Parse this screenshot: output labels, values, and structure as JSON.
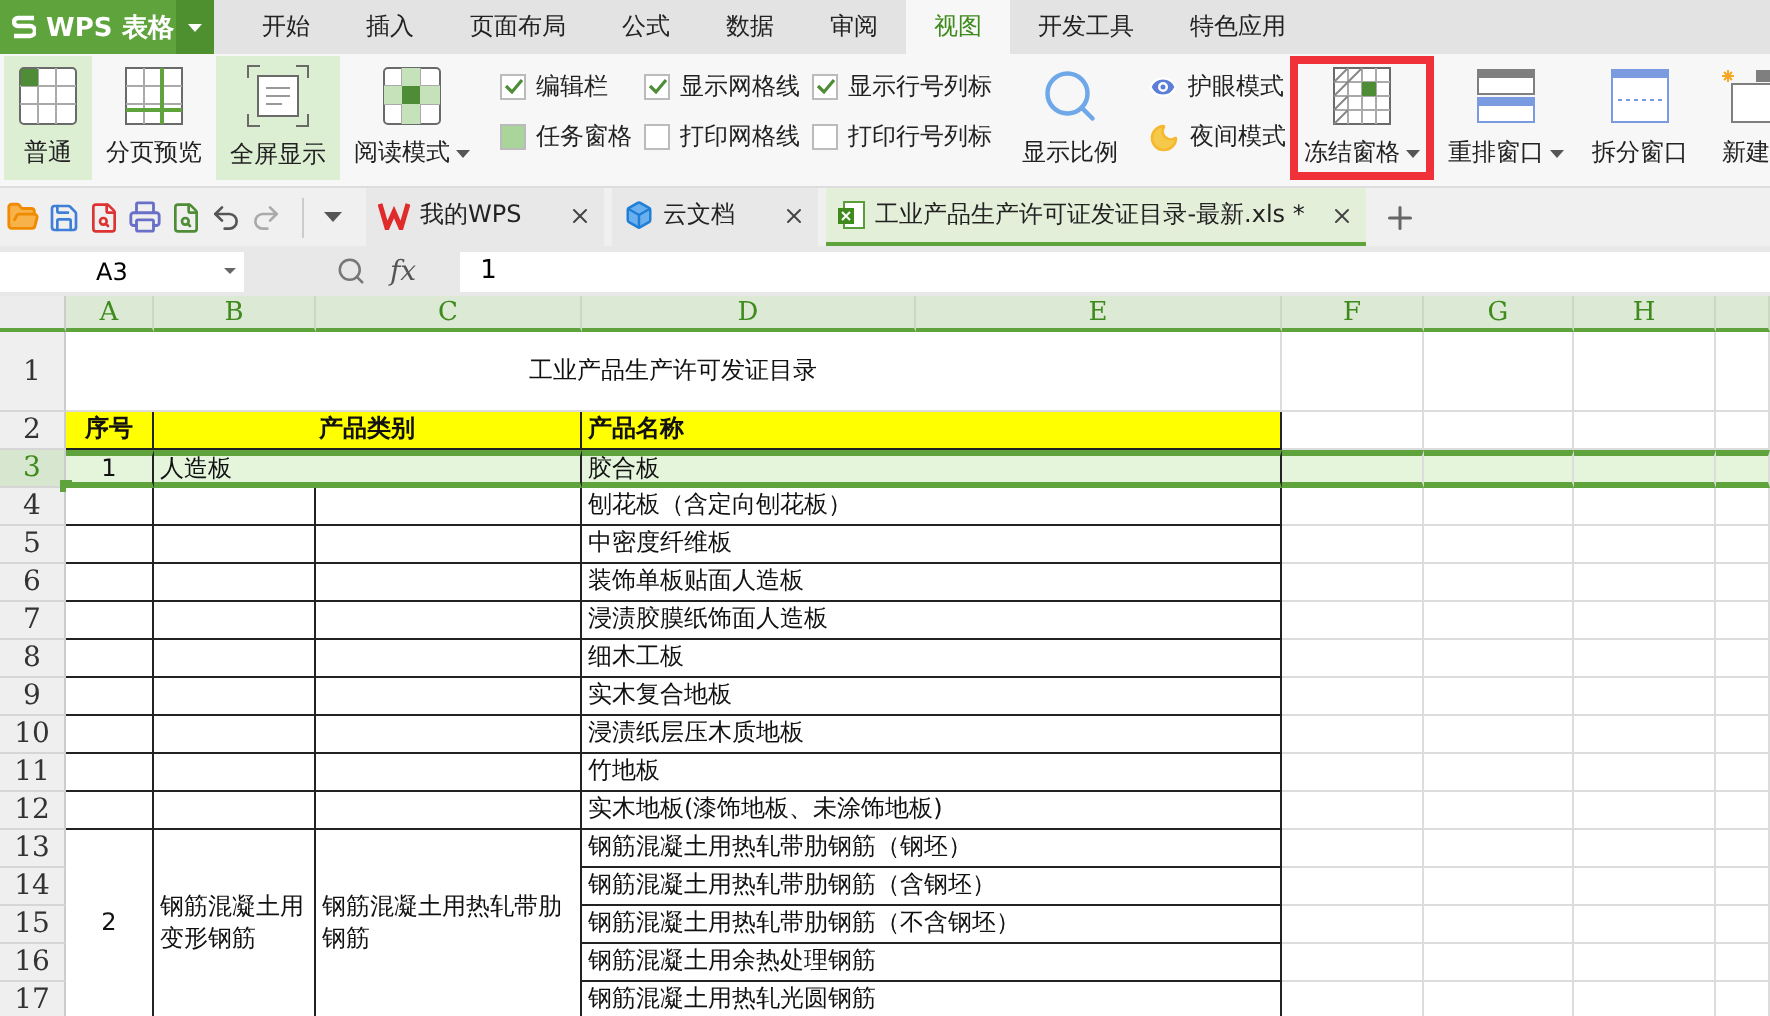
{
  "app": {
    "logo": "WPS 表格"
  },
  "menu_tabs": [
    {
      "label": "开始",
      "selected": false
    },
    {
      "label": "插入",
      "selected": false
    },
    {
      "label": "页面布局",
      "selected": false
    },
    {
      "label": "公式",
      "selected": false
    },
    {
      "label": "数据",
      "selected": false
    },
    {
      "label": "审阅",
      "selected": false
    },
    {
      "label": "视图",
      "selected": true
    },
    {
      "label": "开发工具",
      "selected": false
    },
    {
      "label": "特色应用",
      "selected": false
    }
  ],
  "view_buttons": [
    {
      "label": "普通",
      "kind": "normal",
      "highlighted": true,
      "dropdown": false
    },
    {
      "label": "分页预览",
      "kind": "pagebreak",
      "highlighted": false,
      "dropdown": false
    },
    {
      "label": "全屏显示",
      "kind": "fullscreen",
      "highlighted": true,
      "dropdown": false
    },
    {
      "label": "阅读模式",
      "kind": "reading",
      "highlighted": false,
      "dropdown": true
    }
  ],
  "show_checks": [
    {
      "label": "编辑栏",
      "kind": "tick",
      "checked": true
    },
    {
      "label": "任务窗格",
      "kind": "fill",
      "checked": true
    },
    {
      "label": "显示网格线",
      "kind": "tick",
      "checked": true
    },
    {
      "label": "打印网格线",
      "checked": false
    },
    {
      "label": "显示行号列标",
      "kind": "tick",
      "checked": true
    },
    {
      "label": "打印行号列标",
      "checked": false
    }
  ],
  "zoom_button": {
    "label": "显示比例"
  },
  "mode_buttons": [
    {
      "label": "护眼模式",
      "kind": "eye"
    },
    {
      "label": "夜间模式",
      "kind": "night"
    }
  ],
  "window_buttons": [
    {
      "label": "冻结窗格",
      "kind": "freeze",
      "dropdown": true,
      "framed": true
    },
    {
      "label": "重排窗口",
      "kind": "arrange",
      "dropdown": true,
      "framed": false
    },
    {
      "label": "拆分窗口",
      "kind": "split",
      "dropdown": false,
      "framed": false
    },
    {
      "label": "新建",
      "kind": "new",
      "dropdown": false,
      "framed": false
    }
  ],
  "doc_tabs": [
    {
      "label": "我的WPS",
      "kind": "home",
      "selected": false
    },
    {
      "label": "云文档",
      "kind": "cloud",
      "selected": false
    },
    {
      "label": "工业产品生产许可证发证目录-最新.xls *",
      "kind": "sheet",
      "selected": true
    }
  ],
  "formula_bar": {
    "cell_ref": "A3",
    "fx": "fx",
    "formula": "1"
  },
  "sheet": {
    "columns": [
      "A",
      "B",
      "C",
      "D",
      "E",
      "F",
      "G",
      "H"
    ],
    "row_numbers": [
      {
        "label": "1",
        "selected": false
      },
      {
        "label": "2",
        "selected": false
      },
      {
        "label": "3",
        "selected": true
      },
      {
        "label": "4",
        "selected": false
      },
      {
        "label": "5",
        "selected": false
      },
      {
        "label": "6",
        "selected": false
      },
      {
        "label": "7",
        "selected": false
      },
      {
        "label": "8",
        "selected": false
      },
      {
        "label": "9",
        "selected": false
      },
      {
        "label": "10",
        "selected": false
      },
      {
        "label": "11",
        "selected": false
      },
      {
        "label": "12",
        "selected": false
      },
      {
        "label": "13",
        "selected": false
      },
      {
        "label": "14",
        "selected": false
      },
      {
        "label": "15",
        "selected": false
      },
      {
        "label": "16",
        "selected": false
      },
      {
        "label": "17",
        "selected": false
      }
    ],
    "title": "工业产品生产许可发证目录",
    "header": [
      "序号",
      "产品类别",
      "产品名称"
    ],
    "sections": [
      {
        "number": "1",
        "category": "人造板",
        "names": [
          "胶合板",
          "刨花板（含定向刨花板）",
          "中密度纤维板",
          "装饰单板贴面人造板",
          "浸渍胶膜纸饰面人造板",
          "细木工板",
          "实木复合地板",
          "浸渍纸层压木质地板",
          "竹地板",
          "实木地板(漆饰地板、未涂饰地板)"
        ]
      },
      {
        "number": "2",
        "category": "钢筋混凝土用变形钢筋",
        "subcategory": "钢筋混凝土用热轧带肋钢筋",
        "names": [
          "钢筋混凝土用热轧带肋钢筋（钢坯）",
          "钢筋混凝土用热轧带肋钢筋（含钢坯）",
          "钢筋混凝土用热轧带肋钢筋（不含钢坯）",
          "钢筋混凝土用余热处理钢筋",
          "钢筋混凝土用热轧光圆钢筋"
        ]
      }
    ]
  }
}
